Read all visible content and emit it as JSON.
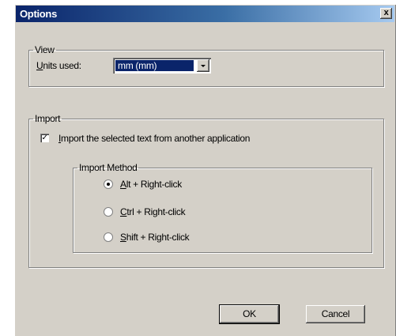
{
  "window": {
    "title": "Options",
    "close_glyph": "x"
  },
  "view_group": {
    "legend": "View",
    "units_label": {
      "mnemonic": "U",
      "rest": "nits used:"
    },
    "units_select": {
      "value": "mm (mm)"
    }
  },
  "import_group": {
    "legend": "Import",
    "import_checkbox": {
      "checked": true,
      "check_glyph": "✓",
      "mnemonic": "I",
      "rest": "mport the selected text from another application"
    },
    "method_group": {
      "legend": "Import Method",
      "options": [
        {
          "mnemonic": "A",
          "rest": "lt + Right-click",
          "selected": true
        },
        {
          "mnemonic": "C",
          "rest": "trl + Right-click",
          "selected": false
        },
        {
          "mnemonic": "S",
          "rest": "hift + Right-click",
          "selected": false
        }
      ]
    }
  },
  "buttons": {
    "ok": "OK",
    "cancel": "Cancel"
  }
}
